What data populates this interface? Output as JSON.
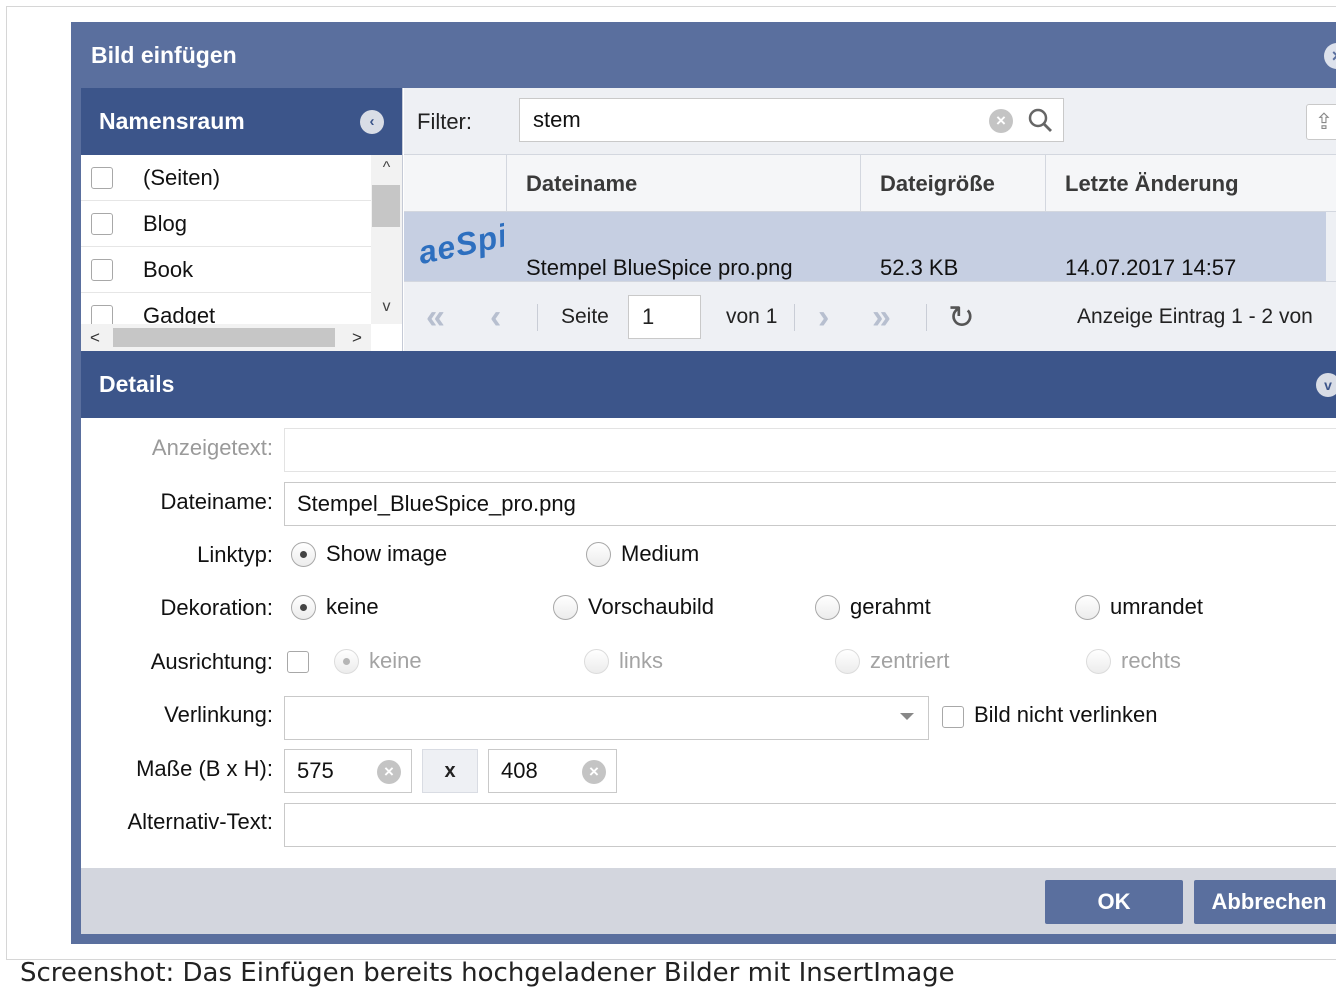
{
  "dialog": {
    "title": "Bild einfügen"
  },
  "namespace": {
    "title": "Namensraum",
    "items": [
      {
        "label": "(Seiten)"
      },
      {
        "label": "Blog"
      },
      {
        "label": "Book"
      },
      {
        "label": "Gadget"
      }
    ]
  },
  "filter": {
    "label": "Filter:",
    "value": "stem"
  },
  "grid": {
    "columns": [
      "Dateiname",
      "Dateigröße",
      "Letzte Änderung"
    ],
    "rows": [
      {
        "thumb_text": "aeSpi",
        "filename": "Stempel BlueSpice pro.png",
        "size": "52.3 KB",
        "modified": "14.07.2017 14:57"
      }
    ]
  },
  "pager": {
    "page_label": "Seite",
    "page_value": "1",
    "of_label": "von 1",
    "display_info": "Anzeige Eintrag 1 - 2 von"
  },
  "details": {
    "title": "Details",
    "display_text": {
      "label": "Anzeigetext:",
      "value": ""
    },
    "filename": {
      "label": "Dateiname:",
      "value": "Stempel_BlueSpice_pro.png"
    },
    "linktype": {
      "label": "Linktyp:",
      "options": [
        "Show image",
        "Medium"
      ],
      "selected": "Show image"
    },
    "decoration": {
      "label": "Dekoration:",
      "options": [
        "keine",
        "Vorschaubild",
        "gerahmt",
        "umrandet"
      ],
      "selected": "keine"
    },
    "alignment": {
      "label": "Ausrichtung:",
      "options": [
        "keine",
        "links",
        "zentriert",
        "rechts"
      ],
      "selected": "keine"
    },
    "link": {
      "label": "Verlinkung:",
      "value": "",
      "nolink_label": "Bild nicht verlinken"
    },
    "dimensions": {
      "label": "Maße (B x H):",
      "width": "575",
      "separator": "x",
      "height": "408"
    },
    "alt_text": {
      "label": "Alternativ-Text:",
      "value": ""
    }
  },
  "buttons": {
    "ok": "OK",
    "cancel": "Abbrechen"
  },
  "caption": "Screenshot: Das Einfügen bereits hochgeladener Bilder mit InsertImage",
  "colors": {
    "header": "#5a6f9e",
    "panel_header": "#3c558a",
    "selected_row": "#c6cfe2"
  }
}
